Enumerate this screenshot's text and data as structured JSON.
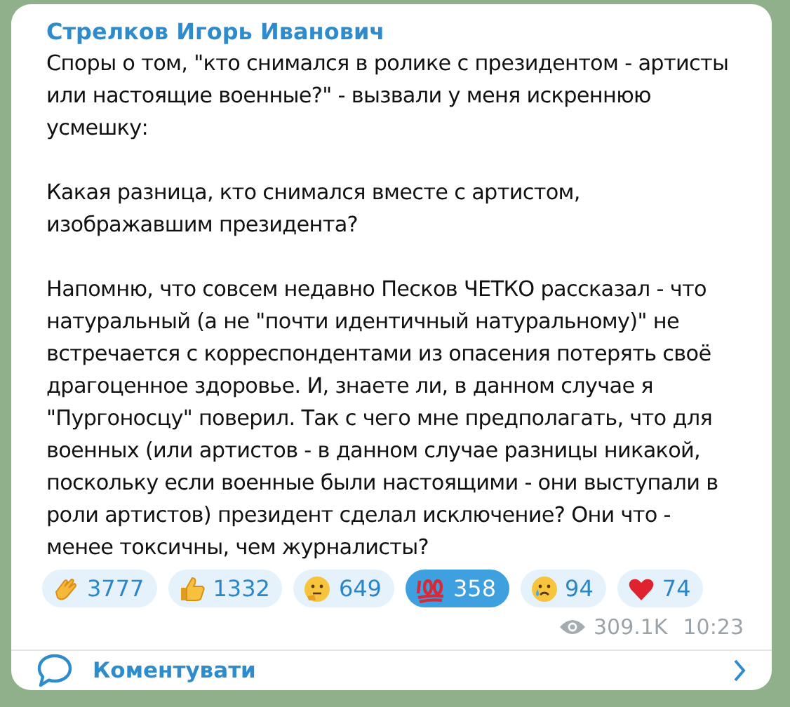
{
  "post": {
    "author": "Стрелков Игорь Иванович",
    "paragraphs": [
      "Споры о том, \"кто снимался в ролике с президентом - артисты или настоящие военные?\" - вызвали у меня искреннюю усмешку:",
      "Какая разница, кто снимался вместе с артистом, изображавшим президента?",
      "Напомню, что совсем недавно Песков ЧЕТКО рассказал - что натуральный (а не \"почти идентичный натуральному)\" не встречается с корреспондентами из опасения потерять своё драгоценное здоровье. И, знаете ли, в данном случае я \"Пургоносцу\" поверил. Так с чего мне предполагать, что для военных (или артистов - в данном случае разницы никакой, поскольку если военные были настоящими - они выступали в роли артистов) президент сделал исключение? Они что - менее токсичны, чем журналисты?"
    ],
    "reactions": [
      {
        "kind": "clap",
        "count": "3777",
        "selected": false
      },
      {
        "kind": "thumbs",
        "count": "1332",
        "selected": false
      },
      {
        "kind": "thinking",
        "count": "649",
        "selected": false
      },
      {
        "kind": "hundred",
        "count": "358",
        "selected": true
      },
      {
        "kind": "crying",
        "count": "94",
        "selected": false
      },
      {
        "kind": "heart",
        "count": "74",
        "selected": false
      }
    ],
    "views": "309.1K",
    "time": "10:23",
    "comment_label": "Коментувати"
  }
}
